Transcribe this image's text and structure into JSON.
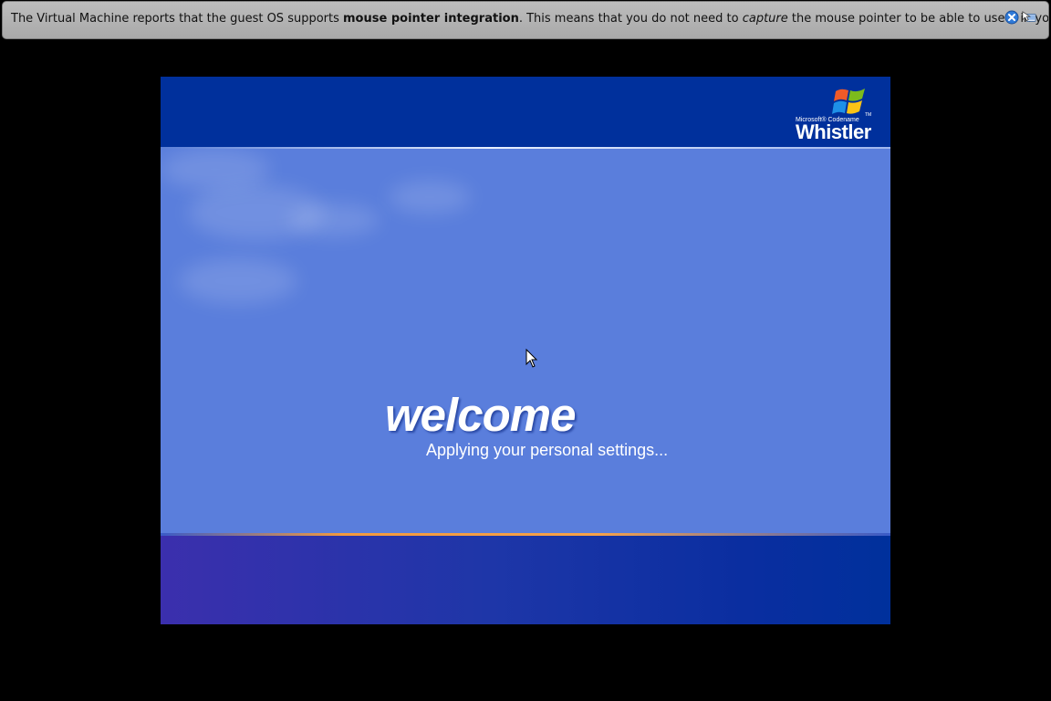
{
  "notification": {
    "text_before": "The Virtual Machine reports that the guest OS supports ",
    "bold_text": "mouse pointer integration",
    "text_middle": ". This means that you do not need to ",
    "italic_text": "capture",
    "text_after": " the mouse pointer to be able to use it in your guest OS --",
    "close_icon": "close-icon",
    "mouse_integration_icon": "mouse-pointer-integration-icon"
  },
  "guest_screen": {
    "logo_small": "Microsoft® Codename",
    "logo_main": "Whistler",
    "logo_tm": "TM",
    "welcome_text": "welcome",
    "status_text": "Applying your personal settings..."
  },
  "colors": {
    "notification_bg": "#b3b3b3",
    "guest_top_band": "#00309c",
    "guest_middle": "#5a7edc",
    "accent_line": "#f39a3e"
  }
}
